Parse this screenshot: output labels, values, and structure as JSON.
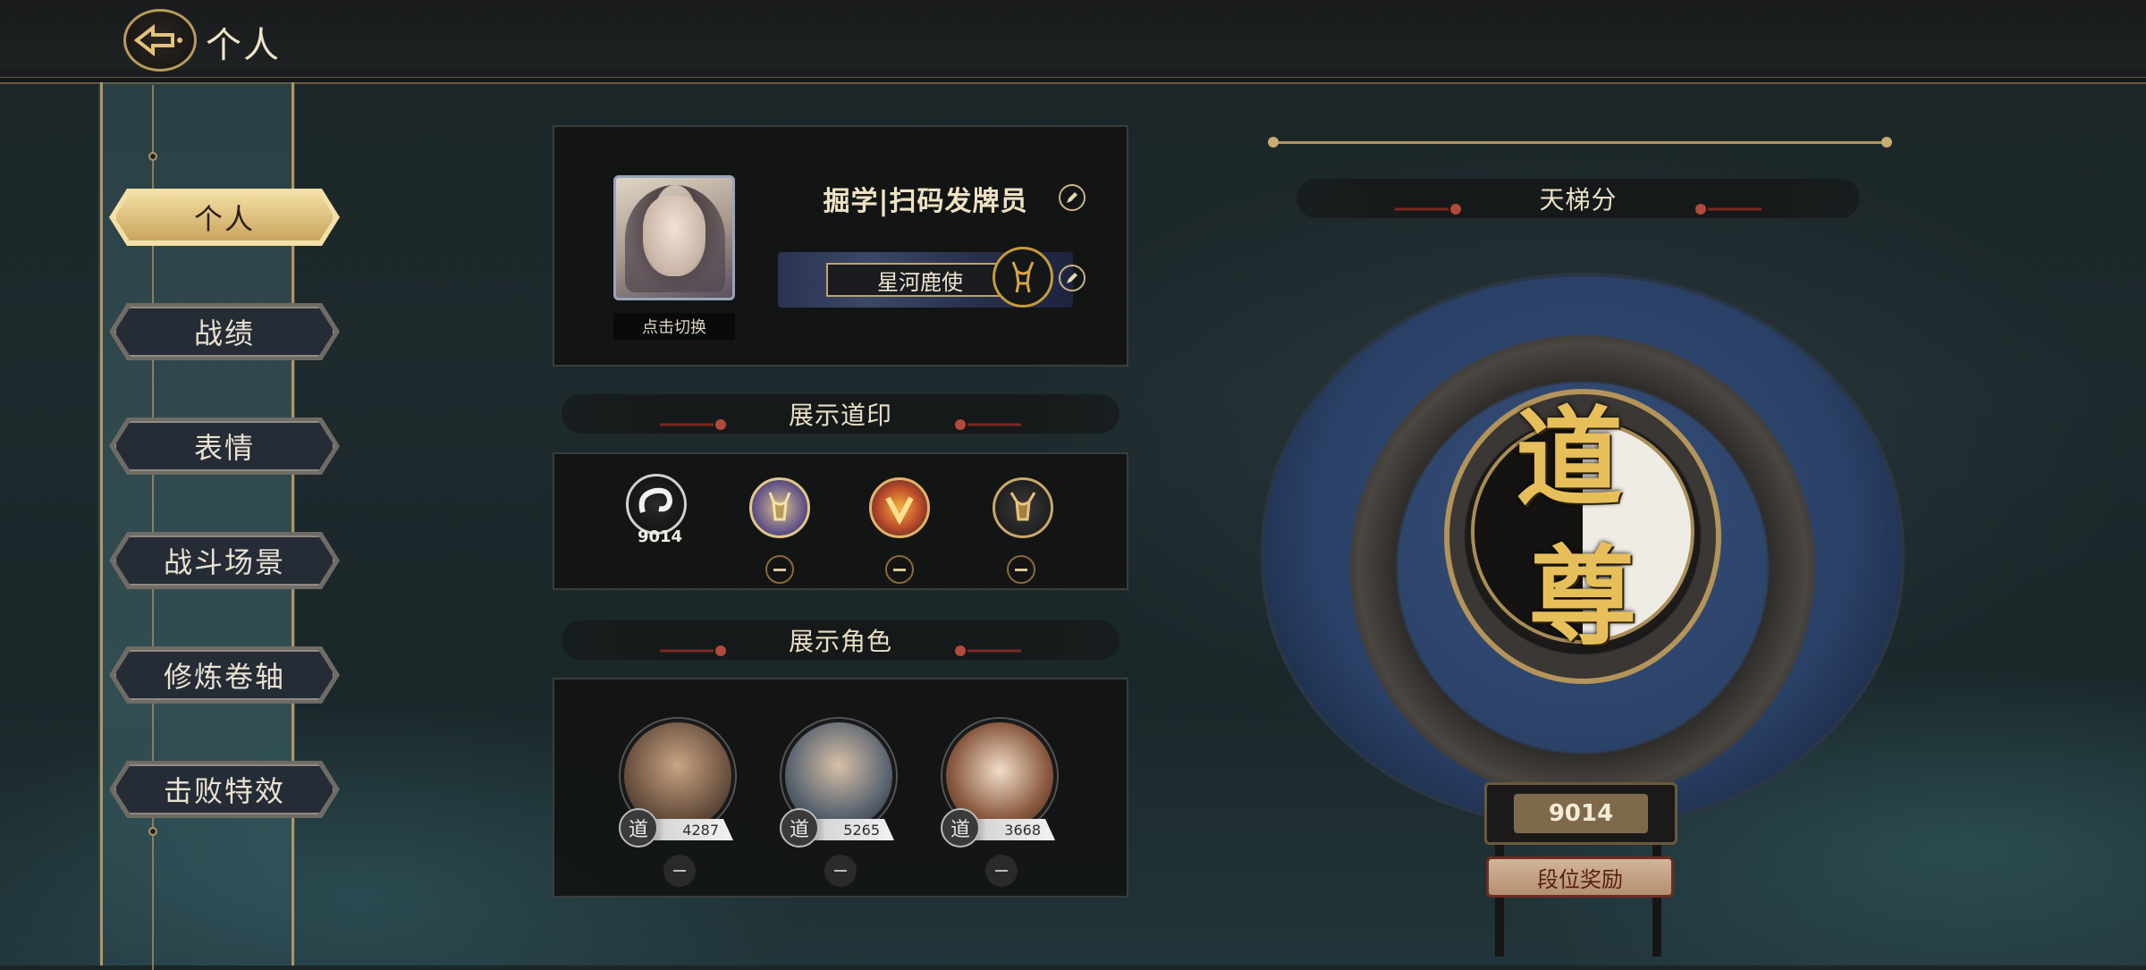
{
  "header": {
    "title": "个人"
  },
  "sidebar": {
    "items": [
      {
        "label": "个人",
        "active": true
      },
      {
        "label": "战绩",
        "active": false
      },
      {
        "label": "表情",
        "active": false
      },
      {
        "label": "战斗场景",
        "active": false
      },
      {
        "label": "修炼卷轴",
        "active": false
      },
      {
        "label": "击败特效",
        "active": false
      }
    ]
  },
  "profile": {
    "avatar_label": "点击切换",
    "name": "掘学|扫码发牌员",
    "title": "星河鹿使"
  },
  "seals": {
    "section_title": "展示道印",
    "items": [
      {
        "value": "9014"
      }
    ]
  },
  "characters": {
    "section_title": "展示角色",
    "items": [
      {
        "badge": "道",
        "value": "4287"
      },
      {
        "badge": "道",
        "value": "5265"
      },
      {
        "badge": "道",
        "value": "3668"
      }
    ]
  },
  "ladder": {
    "section_title": "天梯分",
    "rank_chars": [
      "道",
      "尊"
    ],
    "score": "9014",
    "reward_label": "段位奖励"
  },
  "colors": {
    "gold": "#c8ac70",
    "active_nav": "#e2c27c",
    "panel": "#121414"
  }
}
